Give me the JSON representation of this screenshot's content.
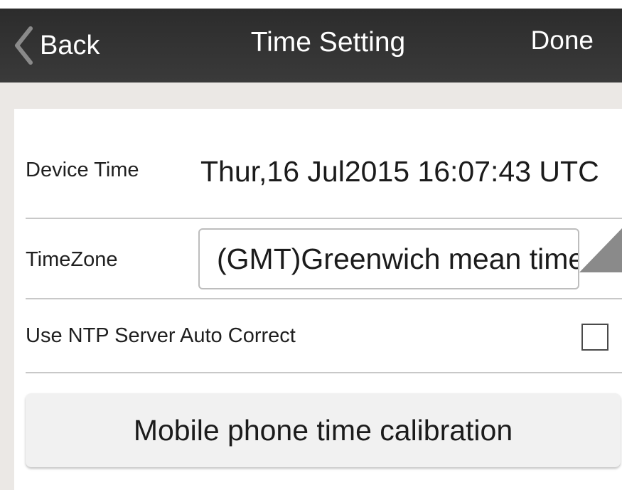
{
  "header": {
    "back_label": "Back",
    "title": "Time Setting",
    "done_label": "Done"
  },
  "rows": {
    "device_time": {
      "label": "Device Time",
      "value": "Thur,16 Jul2015 16:07:43  UTC"
    },
    "timezone": {
      "label": "TimeZone",
      "value": "(GMT)Greenwich mean time"
    },
    "ntp": {
      "label": "Use NTP Server Auto Correct",
      "checked": false
    }
  },
  "calibration_button": {
    "label": "Mobile phone time calibration"
  },
  "colors": {
    "header_bg": "#333333",
    "page_band": "#ebe8e5",
    "divider": "#c8c8c8",
    "dropdown_arrow": "#8a8a8a"
  },
  "icons": {
    "back": "chevron-left-icon",
    "dropdown": "dropdown-triangle-icon"
  }
}
